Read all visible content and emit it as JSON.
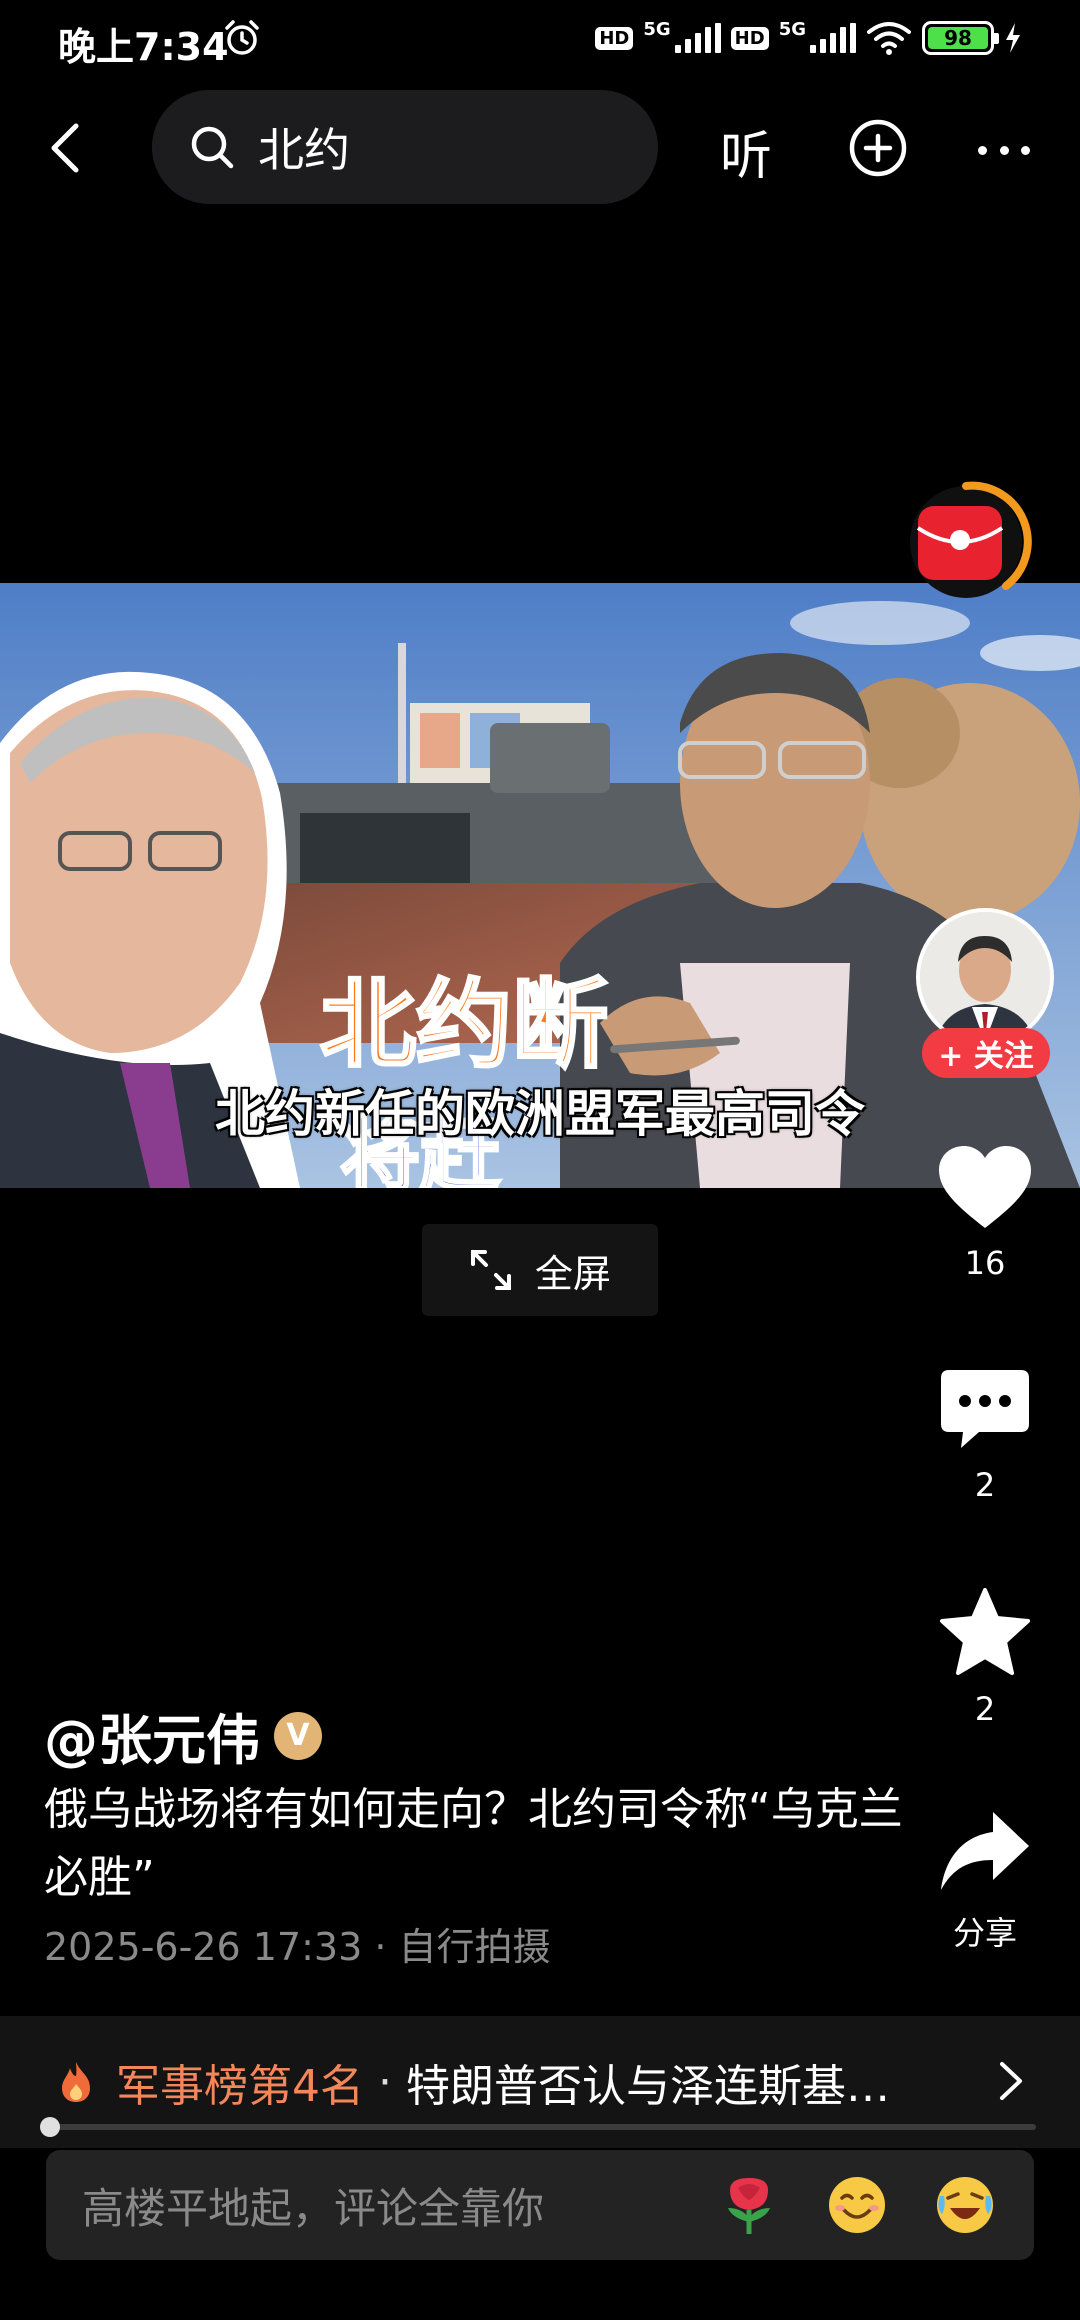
{
  "status_bar": {
    "time": "晚上7:34",
    "hd1": "HD",
    "net1": "5G",
    "hd2": "HD",
    "net2": "5G",
    "battery": "98"
  },
  "top_bar": {
    "search_query": "北约",
    "listen_label": "听"
  },
  "video": {
    "subtitle": "北约新任的欧洲盟军最高司令",
    "fullscreen_label": "全屏"
  },
  "actions": {
    "follow_label": "+ 关注",
    "like_count": "16",
    "comment_count": "2",
    "favorite_count": "2",
    "share_label": "分享"
  },
  "post": {
    "author": "@张元伟",
    "verified_mark": "V",
    "title": "俄乌战场将有如何走向？北约司令称“乌克兰必胜”",
    "meta": "2025-6-26 17:33 · 自行拍摄"
  },
  "hot_banner": {
    "rank": "军事榜第4名",
    "separator": "·",
    "topic": "特朗普否认与泽连斯基…"
  },
  "playback": {
    "progress_fraction": 0.01
  },
  "comment_bar": {
    "placeholder": "高楼平地起，评论全靠你"
  },
  "colors": {
    "accent_red": "#f23b43",
    "rank_orange": "#f3865a",
    "battery_green": "#4ee04b"
  },
  "icons": [
    "back-arrow-icon",
    "search-icon",
    "plus-circle-icon",
    "more-icon",
    "red-packet-icon",
    "fullscreen-icon",
    "heart-icon",
    "comment-icon",
    "star-icon",
    "share-icon",
    "fire-icon",
    "chevron-right-icon",
    "rose-emoji",
    "smile-emoji",
    "laugh-cry-emoji"
  ]
}
